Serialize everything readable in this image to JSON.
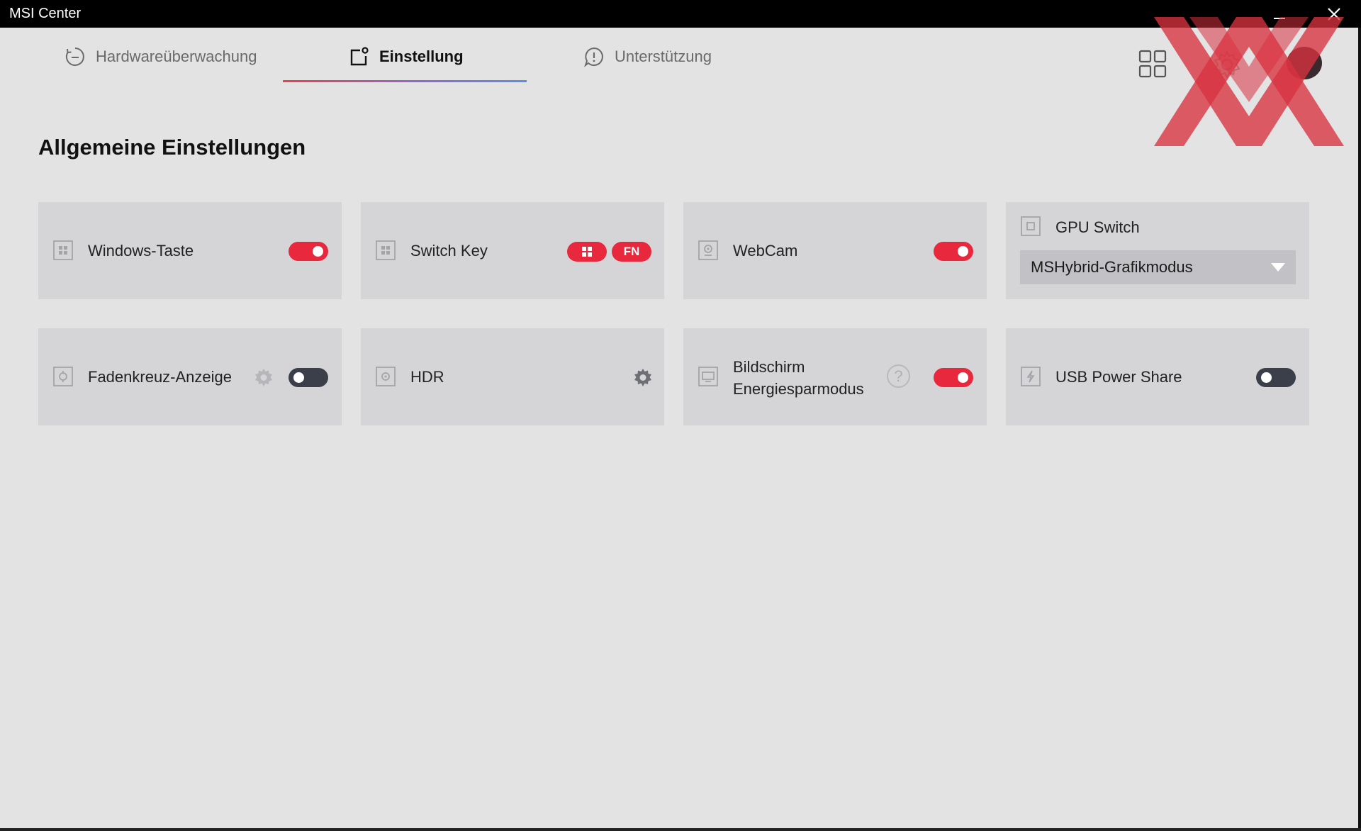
{
  "window": {
    "title": "MSI Center",
    "minimize_icon": "minimize-icon",
    "close_icon": "close-icon"
  },
  "tabs": [
    {
      "label": "Hardwareüberwachung",
      "icon": "speedometer-icon",
      "active": false
    },
    {
      "label": "Einstellung",
      "icon": "settings-square-icon",
      "active": true
    },
    {
      "label": "Unterstützung",
      "icon": "support-chat-icon",
      "active": false
    }
  ],
  "header_icons": [
    "apps-grid-icon",
    "gear-icon",
    "avatar-icon"
  ],
  "section": {
    "title": "Allgemeine Einstellungen"
  },
  "cards": {
    "windows_key": {
      "label": "Windows-Taste",
      "icon": "windows-key-icon",
      "toggle": "on"
    },
    "switch_key": {
      "label": "Switch Key",
      "icon": "windows-key-icon",
      "win_badge_icon": "windows-logo-icon",
      "fn_label": "FN"
    },
    "webcam": {
      "label": "WebCam",
      "icon": "webcam-icon",
      "toggle": "on"
    },
    "gpu_switch": {
      "label": "GPU Switch",
      "icon": "gpu-chip-icon",
      "selected": "MSHybrid-Grafikmodus"
    },
    "crosshair": {
      "label": "Fadenkreuz-Anzeige",
      "icon": "crosshair-icon",
      "toggle": "off"
    },
    "hdr": {
      "label": "HDR",
      "icon": "hdr-icon"
    },
    "screen_power": {
      "label_line1": "Bildschirm",
      "label_line2": "Energiesparmodus",
      "icon": "monitor-icon",
      "help": "?",
      "toggle": "on"
    },
    "usb_power": {
      "label": "USB Power Share",
      "icon": "usb-power-icon",
      "toggle": "off"
    }
  },
  "colors": {
    "accent_red": "#e8293d",
    "toggle_off": "#3b3f4a",
    "card_bg": "#d5d5d8",
    "page_bg": "#e3e3e4"
  }
}
